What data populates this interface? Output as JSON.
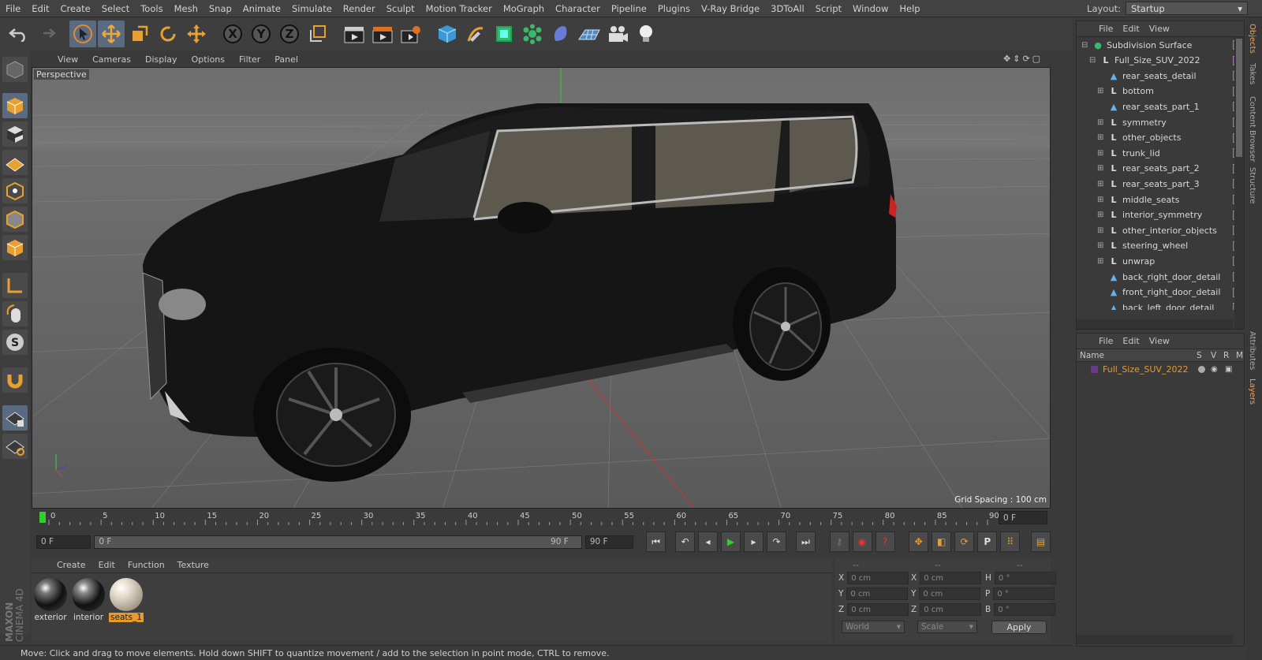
{
  "menu": [
    "File",
    "Edit",
    "Create",
    "Select",
    "Tools",
    "Mesh",
    "Snap",
    "Animate",
    "Simulate",
    "Render",
    "Sculpt",
    "Motion Tracker",
    "MoGraph",
    "Character",
    "Pipeline",
    "Plugins",
    "V-Ray Bridge",
    "3DToAll",
    "Script",
    "Window",
    "Help"
  ],
  "layout": {
    "label": "Layout:",
    "value": "Startup"
  },
  "axes": [
    "X",
    "Y",
    "Z"
  ],
  "viewport": {
    "menu": [
      "View",
      "Cameras",
      "Display",
      "Options",
      "Filter",
      "Panel"
    ],
    "camera": "Perspective",
    "grid_spacing": "Grid Spacing : 100 cm"
  },
  "timeline": {
    "ticks": [
      "0",
      "5",
      "10",
      "15",
      "20",
      "25",
      "30",
      "35",
      "40",
      "45",
      "50",
      "55",
      "60",
      "65",
      "70",
      "75",
      "80",
      "85",
      "90"
    ],
    "end_field": "0 F"
  },
  "transport": {
    "current": "0 F",
    "slider_start": "0 F",
    "slider_end": "90 F",
    "max": "90 F"
  },
  "materials": {
    "menu": [
      "Create",
      "Edit",
      "Function",
      "Texture"
    ],
    "items": [
      {
        "name": "exterior",
        "selected": false
      },
      {
        "name": "interior",
        "selected": false
      },
      {
        "name": "seats_1",
        "selected": true
      }
    ]
  },
  "coords": {
    "header": [
      "--",
      "--",
      "--"
    ],
    "rows": [
      {
        "a": "X",
        "av": "0 cm",
        "b": "X",
        "bv": "0 cm",
        "c": "H",
        "cv": "0 °"
      },
      {
        "a": "Y",
        "av": "0 cm",
        "b": "Y",
        "bv": "0 cm",
        "c": "P",
        "cv": "0 °"
      },
      {
        "a": "Z",
        "av": "0 cm",
        "b": "Z",
        "bv": "0 cm",
        "c": "B",
        "cv": "0 °"
      }
    ],
    "world": "World",
    "scale": "Scale",
    "apply": "Apply"
  },
  "brand": {
    "maxon": "MAXON",
    "cinema": "CINEMA 4D"
  },
  "status": "Move: Click and drag to move elements. Hold down SHIFT to quantize movement / add to the selection in point mode, CTRL to remove.",
  "objects": {
    "menu": [
      "File",
      "Edit",
      "View"
    ],
    "items": [
      {
        "name": "Subdivision Surface",
        "indent": 0,
        "kind": "subdiv",
        "expand": "-"
      },
      {
        "name": "Full_Size_SUV_2022",
        "indent": 1,
        "kind": "null",
        "expand": "-"
      },
      {
        "name": "rear_seats_detail",
        "indent": 2,
        "kind": "poly",
        "expand": ""
      },
      {
        "name": "bottom",
        "indent": 2,
        "kind": "null",
        "expand": "+"
      },
      {
        "name": "rear_seats_part_1",
        "indent": 2,
        "kind": "poly",
        "expand": ""
      },
      {
        "name": "symmetry",
        "indent": 2,
        "kind": "null",
        "expand": "+"
      },
      {
        "name": "other_objects",
        "indent": 2,
        "kind": "null",
        "expand": "+"
      },
      {
        "name": "trunk_lid",
        "indent": 2,
        "kind": "null",
        "expand": "+"
      },
      {
        "name": "rear_seats_part_2",
        "indent": 2,
        "kind": "null",
        "expand": "+"
      },
      {
        "name": "rear_seats_part_3",
        "indent": 2,
        "kind": "null",
        "expand": "+"
      },
      {
        "name": "middle_seats",
        "indent": 2,
        "kind": "null",
        "expand": "+"
      },
      {
        "name": "interior_symmetry",
        "indent": 2,
        "kind": "null",
        "expand": "+"
      },
      {
        "name": "other_interior_objects",
        "indent": 2,
        "kind": "null",
        "expand": "+"
      },
      {
        "name": "steering_wheel",
        "indent": 2,
        "kind": "null",
        "expand": "+"
      },
      {
        "name": "unwrap",
        "indent": 2,
        "kind": "null",
        "expand": "+"
      },
      {
        "name": "back_right_door_detail",
        "indent": 2,
        "kind": "poly",
        "expand": ""
      },
      {
        "name": "front_right_door_detail",
        "indent": 2,
        "kind": "poly",
        "expand": ""
      },
      {
        "name": "back_left_door_detail",
        "indent": 2,
        "kind": "poly",
        "expand": ""
      }
    ]
  },
  "layers": {
    "menu": [
      "File",
      "Edit",
      "View"
    ],
    "columns": [
      "Name",
      "S",
      "V",
      "R",
      "M"
    ],
    "row": "Full_Size_SUV_2022",
    "accent": "#e89a2a",
    "layer_color": "#6a3a8a"
  },
  "right_tabs": [
    {
      "label": "Objects",
      "active": true
    },
    {
      "label": "Takes",
      "active": false
    },
    {
      "label": "Content Browser",
      "active": false
    },
    {
      "label": "Structure",
      "active": false
    },
    {
      "label": "Attributes",
      "active": false
    },
    {
      "label": "Layers",
      "active": true
    }
  ]
}
